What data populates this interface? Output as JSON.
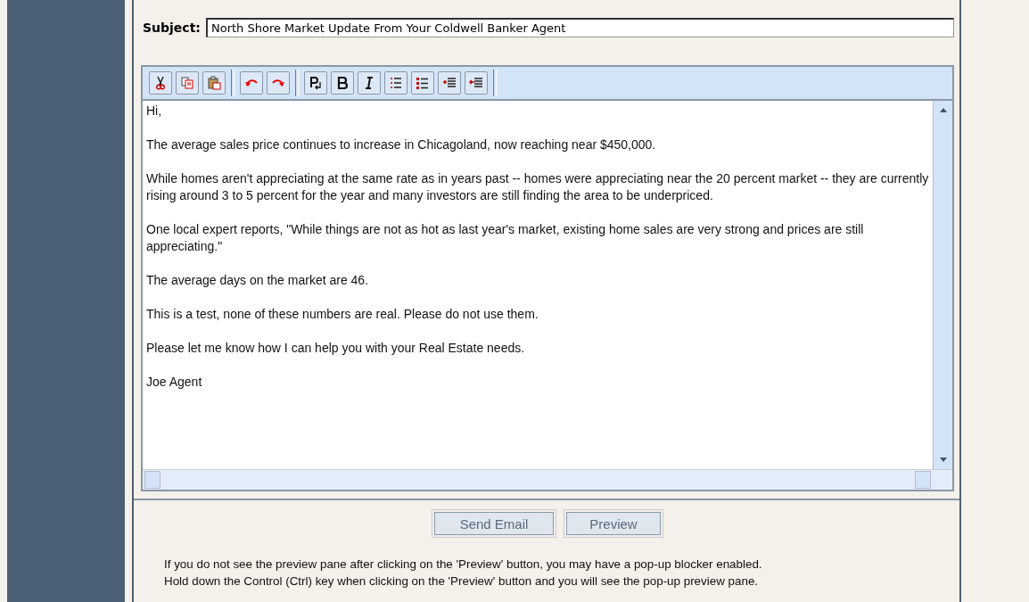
{
  "subject": {
    "label": "Subject:",
    "value": "North Shore Market Update From Your Coldwell Banker Agent"
  },
  "body": [
    "Hi,",
    "The average sales price continues to increase in Chicagoland, now reaching near $450,000.",
    "While homes aren't appreciating at the same rate as in years past -- homes were appreciating near the 20 percent market -- they are currently rising around 3 to 5 percent for the year and many investors are still finding the area to be underpriced.",
    "One local expert reports, \"While things are not as hot as last year's market, existing home sales are very strong and prices are still appreciating.\"",
    "The average days on the market are 46.",
    "This is a test, none of these numbers are real.  Please do not use them.",
    "Please let me know how I can help you with your Real Estate needs.",
    "Joe Agent"
  ],
  "buttons": [
    "Send Email",
    "Preview"
  ],
  "notice": [
    "If you do not see the preview pane after clicking on the 'Preview' button, you may have a pop-up blocker enabled.",
    "Hold down the Control (Ctrl) key when clicking on the 'Preview' button and you will see the pop-up preview pane."
  ]
}
